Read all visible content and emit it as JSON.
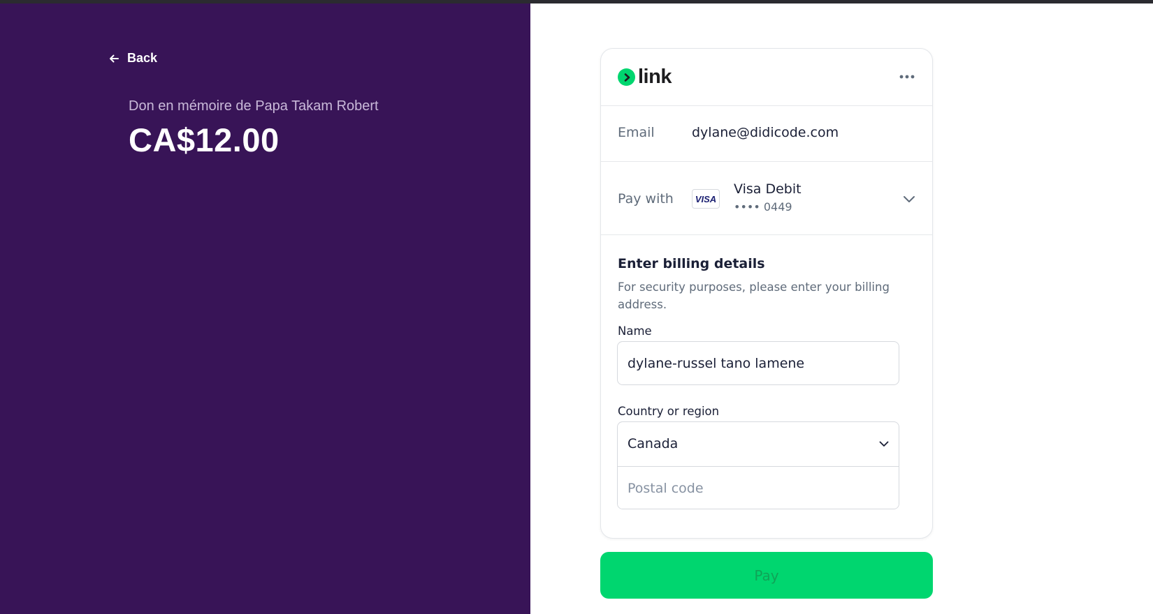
{
  "left_panel": {
    "back_label": "Back",
    "donation_title": "Don en mémoire de Papa Takam Robert",
    "amount": "CA$12.00"
  },
  "link_card": {
    "logo_text": "link",
    "email": {
      "label": "Email",
      "value": "dylane@didicode.com"
    },
    "pay_with": {
      "label": "Pay with",
      "card_network": "VISA",
      "card_brand": "Visa Debit",
      "card_last4": "•••• 0449"
    },
    "billing": {
      "title": "Enter billing details",
      "description": "For security purposes, please enter your billing address.",
      "name_label": "Name",
      "name_value": "dylane-russel tano lamene",
      "country_label": "Country or region",
      "country_value": "Canada",
      "postal_placeholder": "Postal code"
    }
  },
  "pay_button_label": "Pay",
  "colors": {
    "left_bg": "#381457",
    "link_green": "#00d66f",
    "text_primary": "#1a1f36",
    "text_secondary": "#5f6b7a"
  }
}
